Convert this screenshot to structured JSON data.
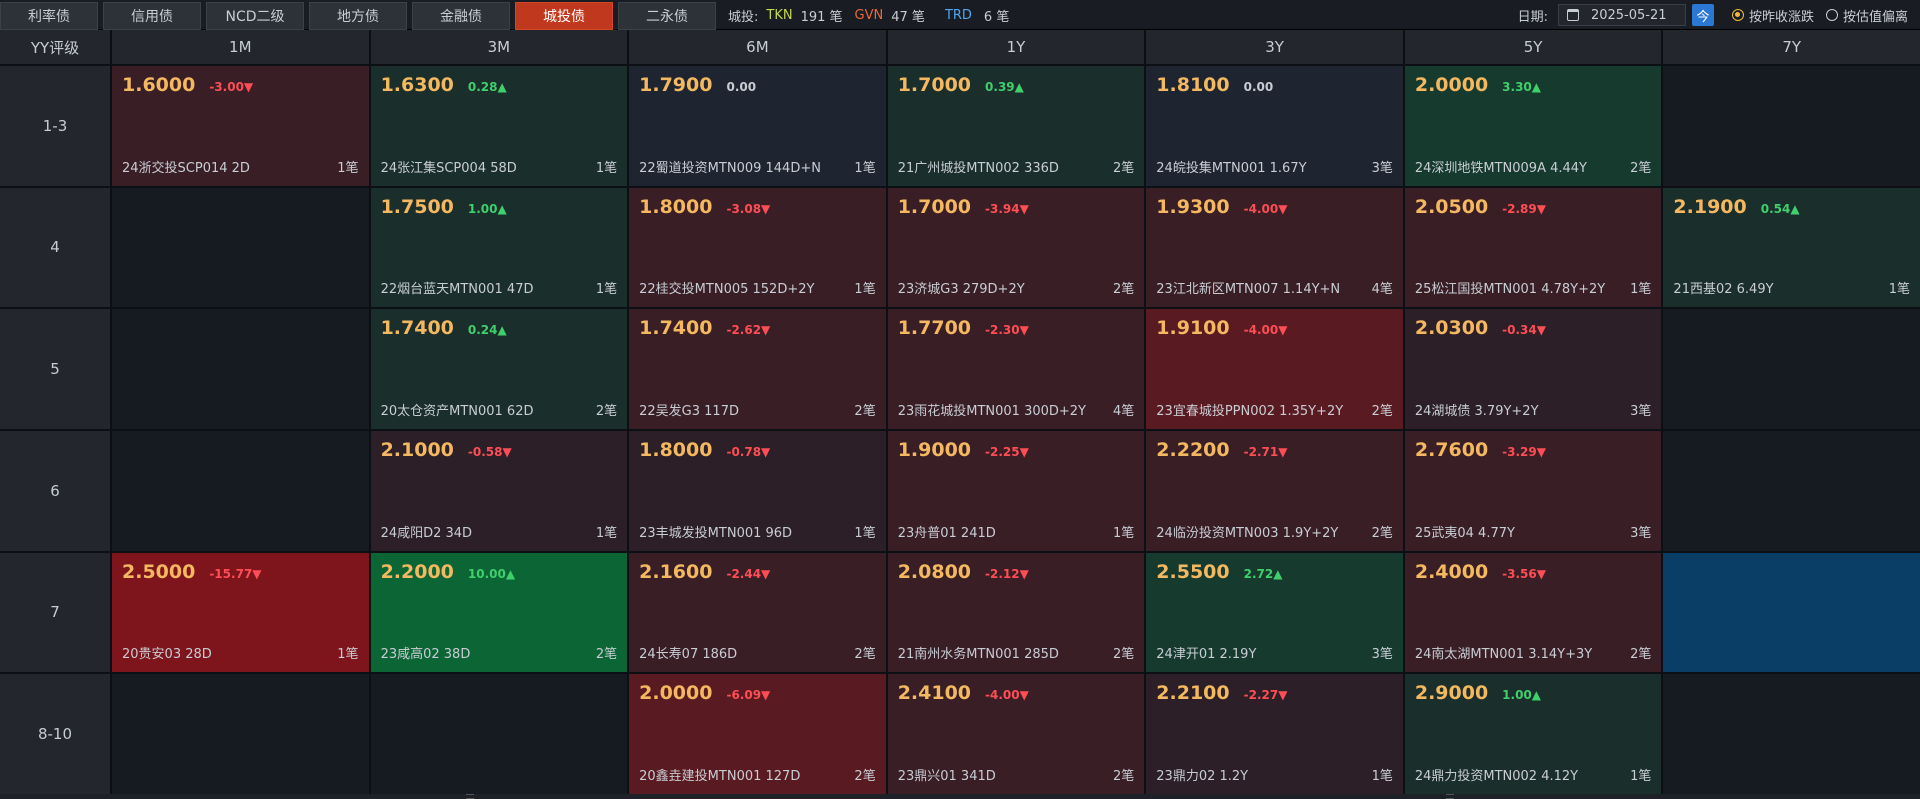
{
  "tabs": [
    {
      "label": "利率债",
      "active": false
    },
    {
      "label": "信用债",
      "active": false
    },
    {
      "label": "NCD二级",
      "active": false
    },
    {
      "label": "地方债",
      "active": false
    },
    {
      "label": "金融债",
      "active": false
    },
    {
      "label": "城投债",
      "active": true
    },
    {
      "label": "二永债",
      "active": false
    }
  ],
  "stats": {
    "prefix": "城投:",
    "tkn_label": "TKN",
    "tkn_value": "191 笔",
    "gvn_label": "GVN",
    "gvn_value": "47 笔",
    "trd_label": "TRD",
    "trd_value": "6 笔"
  },
  "controls": {
    "date_label": "日期:",
    "date_value": "2025-05-21",
    "today_label": "今",
    "radio1_label": "按昨收涨跌",
    "radio2_label": "按估值偏离"
  },
  "header": {
    "corner": "YY评级",
    "columns": [
      "1M",
      "3M",
      "6M",
      "1Y",
      "3Y",
      "5Y",
      "7Y"
    ]
  },
  "colors": {
    "red_strong": "#7e141c",
    "red_mid": "#5a1a22",
    "red_light": "#3a1e26",
    "red_faint": "#2c1f27",
    "green_strong": "#0b6535",
    "green_light": "#163a2e",
    "green_faint": "#1a2e2c",
    "neutral": "#1e2530",
    "blue": "#0b3e66",
    "empty": "#161b22"
  },
  "rows": [
    {
      "label": "1-3",
      "cells": [
        {
          "yield": "1.6000",
          "chg": "-3.00▼",
          "dir": "dn",
          "bond": "24浙交投SCP014 2D",
          "count": "1笔",
          "bg": "red_light"
        },
        {
          "yield": "1.6300",
          "chg": "0.28▲",
          "dir": "up",
          "bond": "24张江集SCP004 58D",
          "count": "1笔",
          "bg": "green_faint"
        },
        {
          "yield": "1.7900",
          "chg": "0.00",
          "dir": "flat",
          "bond": "22蜀道投资MTN009 144D+N",
          "count": "1笔",
          "bg": "neutral"
        },
        {
          "yield": "1.7000",
          "chg": "0.39▲",
          "dir": "up",
          "bond": "21广州城投MTN002 336D",
          "count": "2笔",
          "bg": "green_faint"
        },
        {
          "yield": "1.8100",
          "chg": "0.00",
          "dir": "flat",
          "bond": "24皖投集MTN001 1.67Y",
          "count": "3笔",
          "bg": "neutral"
        },
        {
          "yield": "2.0000",
          "chg": "3.30▲",
          "dir": "up",
          "bond": "24深圳地铁MTN009A 4.44Y",
          "count": "2笔",
          "bg": "green_light"
        },
        null
      ]
    },
    {
      "label": "4",
      "cells": [
        null,
        {
          "yield": "1.7500",
          "chg": "1.00▲",
          "dir": "up",
          "bond": "22烟台蓝天MTN001 47D",
          "count": "1笔",
          "bg": "green_faint"
        },
        {
          "yield": "1.8000",
          "chg": "-3.08▼",
          "dir": "dn",
          "bond": "22桂交投MTN005 152D+2Y",
          "count": "1笔",
          "bg": "red_light"
        },
        {
          "yield": "1.7000",
          "chg": "-3.94▼",
          "dir": "dn",
          "bond": "23济城G3 279D+2Y",
          "count": "2笔",
          "bg": "red_light"
        },
        {
          "yield": "1.9300",
          "chg": "-4.00▼",
          "dir": "dn",
          "bond": "23江北新区MTN007 1.14Y+N",
          "count": "4笔",
          "bg": "red_light"
        },
        {
          "yield": "2.0500",
          "chg": "-2.89▼",
          "dir": "dn",
          "bond": "25松江国投MTN001 4.78Y+2Y",
          "count": "1笔",
          "bg": "red_light"
        },
        {
          "yield": "2.1900",
          "chg": "0.54▲",
          "dir": "up",
          "bond": "21西基02 6.49Y",
          "count": "1笔",
          "bg": "green_faint"
        }
      ]
    },
    {
      "label": "5",
      "cells": [
        null,
        {
          "yield": "1.7400",
          "chg": "0.24▲",
          "dir": "up",
          "bond": "20太仓资产MTN001 62D",
          "count": "2笔",
          "bg": "green_faint"
        },
        {
          "yield": "1.7400",
          "chg": "-2.62▼",
          "dir": "dn",
          "bond": "22吴发G3 117D",
          "count": "2笔",
          "bg": "red_light"
        },
        {
          "yield": "1.7700",
          "chg": "-2.30▼",
          "dir": "dn",
          "bond": "23雨花城投MTN001 300D+2Y",
          "count": "4笔",
          "bg": "red_light"
        },
        {
          "yield": "1.9100",
          "chg": "-4.00▼",
          "dir": "dn",
          "bond": "23宜春城投PPN002 1.35Y+2Y",
          "count": "2笔",
          "bg": "red_mid"
        },
        {
          "yield": "2.0300",
          "chg": "-0.34▼",
          "dir": "dn",
          "bond": "24湖城债 3.79Y+2Y",
          "count": "3笔",
          "bg": "red_faint"
        },
        null
      ]
    },
    {
      "label": "6",
      "cells": [
        null,
        {
          "yield": "2.1000",
          "chg": "-0.58▼",
          "dir": "dn",
          "bond": "24咸阳D2 34D",
          "count": "1笔",
          "bg": "red_faint"
        },
        {
          "yield": "1.8000",
          "chg": "-0.78▼",
          "dir": "dn",
          "bond": "23丰城发投MTN001 96D",
          "count": "1笔",
          "bg": "red_faint"
        },
        {
          "yield": "1.9000",
          "chg": "-2.25▼",
          "dir": "dn",
          "bond": "23舟普01 241D",
          "count": "1笔",
          "bg": "red_light"
        },
        {
          "yield": "2.2200",
          "chg": "-2.71▼",
          "dir": "dn",
          "bond": "24临汾投资MTN003 1.9Y+2Y",
          "count": "2笔",
          "bg": "red_light"
        },
        {
          "yield": "2.7600",
          "chg": "-3.29▼",
          "dir": "dn",
          "bond": "25武夷04 4.77Y",
          "count": "3笔",
          "bg": "red_light"
        },
        null
      ]
    },
    {
      "label": "7",
      "cells": [
        {
          "yield": "2.5000",
          "chg": "-15.77▼",
          "dir": "dn",
          "bond": "20贵安03 28D",
          "count": "1笔",
          "bg": "red_strong"
        },
        {
          "yield": "2.2000",
          "chg": "10.00▲",
          "dir": "up",
          "bond": "23咸高02 38D",
          "count": "2笔",
          "bg": "green_strong"
        },
        {
          "yield": "2.1600",
          "chg": "-2.44▼",
          "dir": "dn",
          "bond": "24长寿07 186D",
          "count": "2笔",
          "bg": "red_light"
        },
        {
          "yield": "2.0800",
          "chg": "-2.12▼",
          "dir": "dn",
          "bond": "21南州水务MTN001 285D",
          "count": "2笔",
          "bg": "red_light"
        },
        {
          "yield": "2.5500",
          "chg": "2.72▲",
          "dir": "up",
          "bond": "24津开01 2.19Y",
          "count": "3笔",
          "bg": "green_light"
        },
        {
          "yield": "2.4000",
          "chg": "-3.56▼",
          "dir": "dn",
          "bond": "24南太湖MTN001 3.14Y+3Y",
          "count": "2笔",
          "bg": "red_light"
        },
        {
          "blank": true,
          "bg": "blue"
        }
      ]
    },
    {
      "label": "8-10",
      "cells": [
        null,
        null,
        {
          "yield": "2.0000",
          "chg": "-6.09▼",
          "dir": "dn",
          "bond": "20鑫垚建投MTN001 127D",
          "count": "2笔",
          "bg": "red_mid"
        },
        {
          "yield": "2.4100",
          "chg": "-4.00▼",
          "dir": "dn",
          "bond": "23鼎兴01 341D",
          "count": "2笔",
          "bg": "red_light"
        },
        {
          "yield": "2.2100",
          "chg": "-2.27▼",
          "dir": "dn",
          "bond": "23鼎力02 1.2Y",
          "count": "1笔",
          "bg": "red_faint"
        },
        {
          "yield": "2.9000",
          "chg": "1.00▲",
          "dir": "up",
          "bond": "24鼎力投资MTN002 4.12Y",
          "count": "1笔",
          "bg": "green_faint"
        },
        null
      ]
    }
  ]
}
